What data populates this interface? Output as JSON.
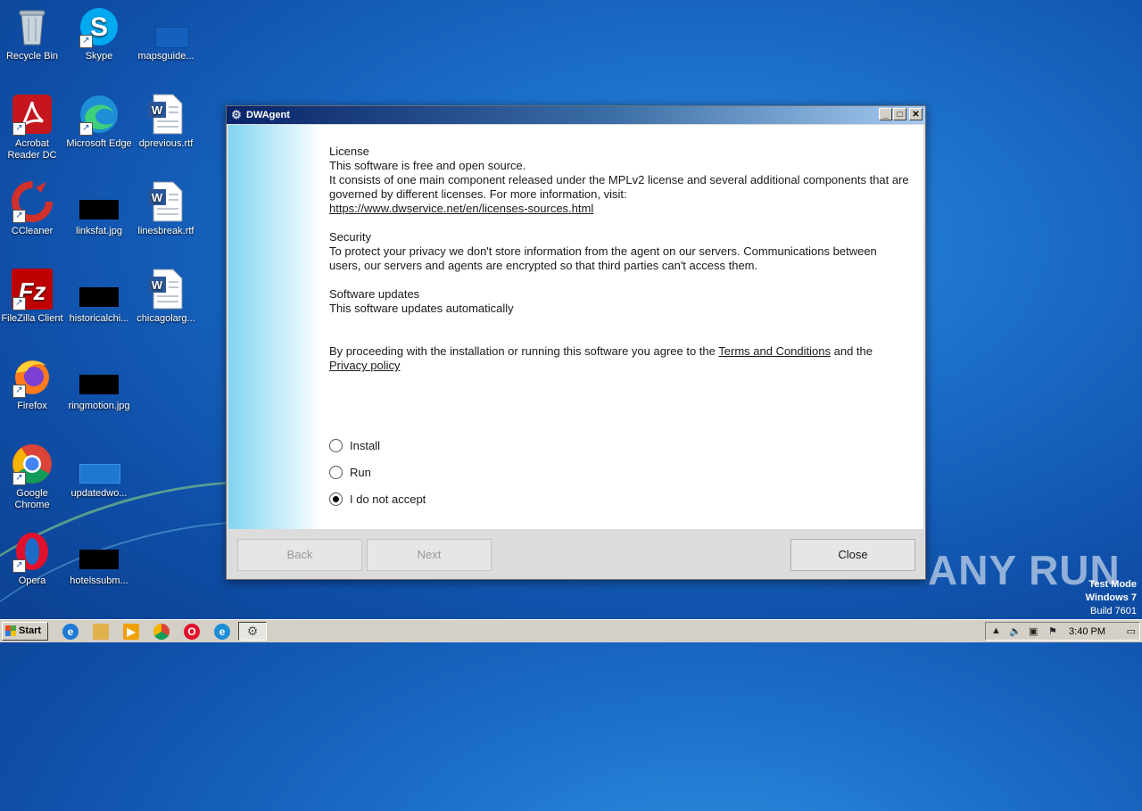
{
  "desktop": {
    "icons": [
      {
        "label": "Recycle Bin"
      },
      {
        "label": "Skype"
      },
      {
        "label": "mapsguide..."
      },
      {
        "label": "Acrobat Reader DC"
      },
      {
        "label": "Microsoft Edge"
      },
      {
        "label": "dprevious.rtf"
      },
      {
        "label": "CCleaner"
      },
      {
        "label": "linksfat.jpg"
      },
      {
        "label": "linesbreak.rtf"
      },
      {
        "label": "FileZilla Client"
      },
      {
        "label": "historicalchi..."
      },
      {
        "label": "chicagolarg..."
      },
      {
        "label": "Firefox"
      },
      {
        "label": "ringmotion.jpg"
      },
      {
        "label": "Google Chrome"
      },
      {
        "label": "updatedwo..."
      },
      {
        "label": "Opera"
      },
      {
        "label": "hotelssubm..."
      }
    ],
    "watermark": "ANY RUN",
    "test_mode": {
      "line1": "Test Mode",
      "line2": "Windows 7",
      "line3": "Build 7601"
    }
  },
  "window": {
    "title": "DWAgent",
    "title_buttons": {
      "minimize": "_",
      "maximize": "□",
      "close": "✕"
    },
    "license_heading": "License",
    "license_line1": "This software is free and open source.",
    "license_line2": "It consists of one main component released under the MPLv2 license and several additional components that are governed by different licenses. For more information, visit:",
    "license_link": "https://www.dwservice.net/en/licenses-sources.html",
    "security_heading": "Security",
    "security_text": "To protect your privacy we don't store information from the agent on our servers. Communications between users, our servers and agents are encrypted so that third parties can't access them.",
    "updates_heading": "Software updates",
    "updates_text": "This software updates automatically",
    "agree_prefix": "By proceeding with the installation or running this software you agree to the",
    "terms_link": "Terms and Conditions",
    "agree_mid": "and the",
    "privacy_link": "Privacy policy",
    "options": [
      {
        "label": "Install",
        "selected": false
      },
      {
        "label": "Run",
        "selected": false
      },
      {
        "label": "I do not accept",
        "selected": true
      }
    ],
    "buttons": {
      "back": "Back",
      "next": "Next",
      "close": "Close"
    }
  },
  "taskbar": {
    "start_label": "Start",
    "clock": "3:40 PM",
    "tray_expand": "▲"
  }
}
